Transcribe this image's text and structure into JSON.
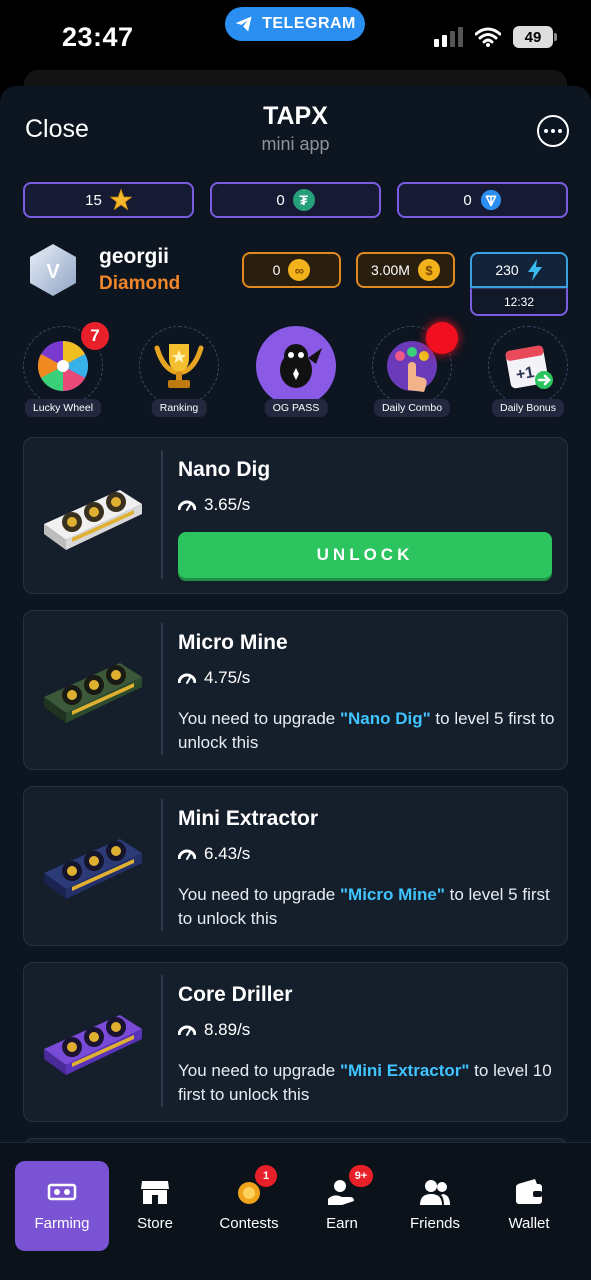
{
  "status_bar": {
    "time": "23:47",
    "telegram_label": "TELEGRAM",
    "battery": "49"
  },
  "header": {
    "close_label": "Close",
    "title": "TAPX",
    "subtitle": "mini app"
  },
  "balances": [
    {
      "value": "15",
      "icon": "star-icon"
    },
    {
      "value": "0",
      "icon": "tether-icon"
    },
    {
      "value": "0",
      "icon": "ton-icon"
    }
  ],
  "profile": {
    "avatar_letter": "V",
    "username": "georgii",
    "rank": "Diamond",
    "gold_value": "0",
    "coins_value": "3.00M",
    "energy_value": "230",
    "energy_timer": "12:32"
  },
  "features": [
    {
      "label": "Lucky Wheel",
      "badge": "7"
    },
    {
      "label": "Ranking"
    },
    {
      "label": "OG PASS"
    },
    {
      "label": "Daily Combo"
    },
    {
      "label": "Daily Bonus",
      "icon_text": "+1"
    }
  ],
  "cards": [
    {
      "name": "Nano Dig",
      "rate": "3.65/s",
      "button": "UNLOCK"
    },
    {
      "name": "Micro Mine",
      "rate": "4.75/s",
      "note_pre": "You need to upgrade ",
      "note_req": "\"Nano Dig\"",
      "note_post": " to level 5 first to unlock this"
    },
    {
      "name": "Mini Extractor",
      "rate": "6.43/s",
      "note_pre": "You need to upgrade ",
      "note_req": "\"Micro Mine\"",
      "note_post": " to level 5 first to unlock this"
    },
    {
      "name": "Core Driller",
      "rate": "8.89/s",
      "note_pre": "You need to upgrade ",
      "note_req": "\"Mini Extractor\"",
      "note_post": " to level 10 first to unlock this"
    }
  ],
  "nav": [
    {
      "label": "Farming",
      "active": true
    },
    {
      "label": "Store"
    },
    {
      "label": "Contests",
      "badge": "1"
    },
    {
      "label": "Earn",
      "badge": "9+"
    },
    {
      "label": "Friends"
    },
    {
      "label": "Wallet"
    }
  ],
  "colors": {
    "accent_purple": "#7b54d6",
    "unlock_green": "#2bc45f",
    "rank_orange": "#f0862b",
    "link_blue": "#3fc4ff",
    "background": "#0c1520"
  }
}
